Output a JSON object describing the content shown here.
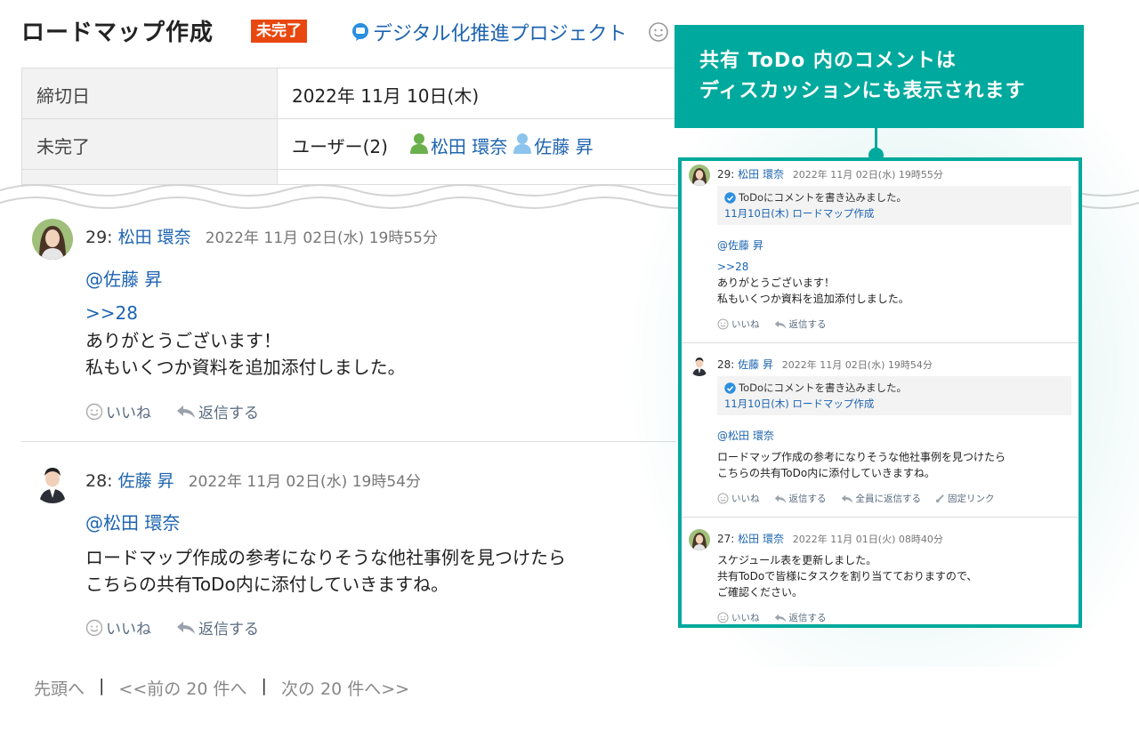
{
  "header": {
    "title": "ロードマップ作成",
    "status": "未完了",
    "project": "デジタル化推進プロジェクト"
  },
  "details": {
    "rows": [
      {
        "label": "締切日",
        "value": "2022年 11月 10日(木)"
      },
      {
        "label": "未完了",
        "value": "ユーザー(2)"
      }
    ],
    "users": [
      "松田 環奈",
      "佐藤 昇"
    ]
  },
  "comments": [
    {
      "num": "29:",
      "author": "松田 環奈",
      "date": "2022年 11月 02日(水) 19時55分",
      "mention": "@佐藤 昇",
      "reply_ref": ">>28",
      "lines": [
        "ありがとうございます！",
        "私もいくつか資料を追加添付しました。"
      ]
    },
    {
      "num": "28:",
      "author": "佐藤 昇",
      "date": "2022年 11月 02日(水) 19時54分",
      "mention": "@松田 環奈",
      "lines": [
        "ロードマップ作成の参考になりそうな他社事例を見つけたら",
        "こちらの共有ToDo内に添付していきますね。"
      ]
    }
  ],
  "actions": {
    "like": "いいね",
    "reply": "返信する",
    "reply_all": "全員に返信する",
    "permalink": "固定リンク"
  },
  "pager": {
    "first": "先頭へ",
    "prev": "<<前の 20 件へ",
    "next": "次の 20 件へ>>",
    "separator": "|"
  },
  "callout": {
    "line1": "共有 ToDo 内のコメントは",
    "line2": "ディスカッションにも表示されます"
  },
  "discussion": {
    "notice_text": "ToDoにコメントを書き込みました。",
    "notice_link": "11月10日(木)  ロードマップ作成",
    "comments": [
      {
        "num": "29:",
        "author": "松田 環奈",
        "date": "2022年 11月 02日(水) 19時55分",
        "mention": "@佐藤 昇",
        "reply_ref": ">>28",
        "lines": [
          "ありがとうございます！",
          "私もいくつか資料を追加添付しました。"
        ]
      },
      {
        "num": "28:",
        "author": "佐藤 昇",
        "date": "2022年 11月 02日(水) 19時54分",
        "mention": "@松田 環奈",
        "lines": [
          "ロードマップ作成の参考になりそうな他社事例を見つけたら",
          "こちらの共有ToDo内に添付していきますね。"
        ]
      },
      {
        "num": "27:",
        "author": "松田 環奈",
        "date": "2022年 11月 01日(火) 08時40分",
        "lines": [
          "スケジュール表を更新しました。",
          "共有ToDoで皆様にタスクを割り当てておりますので、",
          "ご確認ください。"
        ]
      }
    ]
  },
  "colors": {
    "accent": "#00a99d",
    "link": "#1d64b0",
    "badge": "#e8480f"
  },
  "icons": [
    "speech-bubble-icon",
    "smile-icon",
    "reply-arrow-icon",
    "person-icon",
    "check-circle-icon",
    "link-icon"
  ]
}
